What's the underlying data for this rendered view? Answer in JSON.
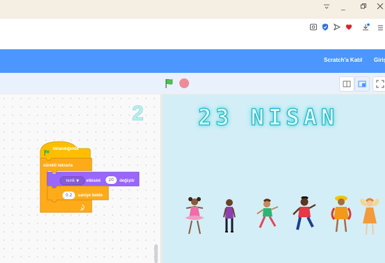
{
  "window_controls": {
    "minimize": "_"
  },
  "menubar": {
    "join_label": "Scratch'a Katıl",
    "signin_label": "Giriş"
  },
  "workspace": {
    "sprite_number": "2"
  },
  "blocks": {
    "hat_label": "tıklandığında",
    "forever_label": "sürekli tekrarla",
    "change_effect_label": "renk",
    "change_effect_middle": "etkisini",
    "change_effect_value": "20",
    "change_effect_suffix": "değiştir",
    "wait_value": "0.2",
    "wait_label": "saniye bekle"
  },
  "stage": {
    "title": "23 NISAN"
  },
  "colors": {
    "menubar": "#4c97ff",
    "events": "#ffbf00",
    "control": "#ffab19",
    "looks": "#9966ff",
    "stage_bg": "#d3eef6"
  }
}
